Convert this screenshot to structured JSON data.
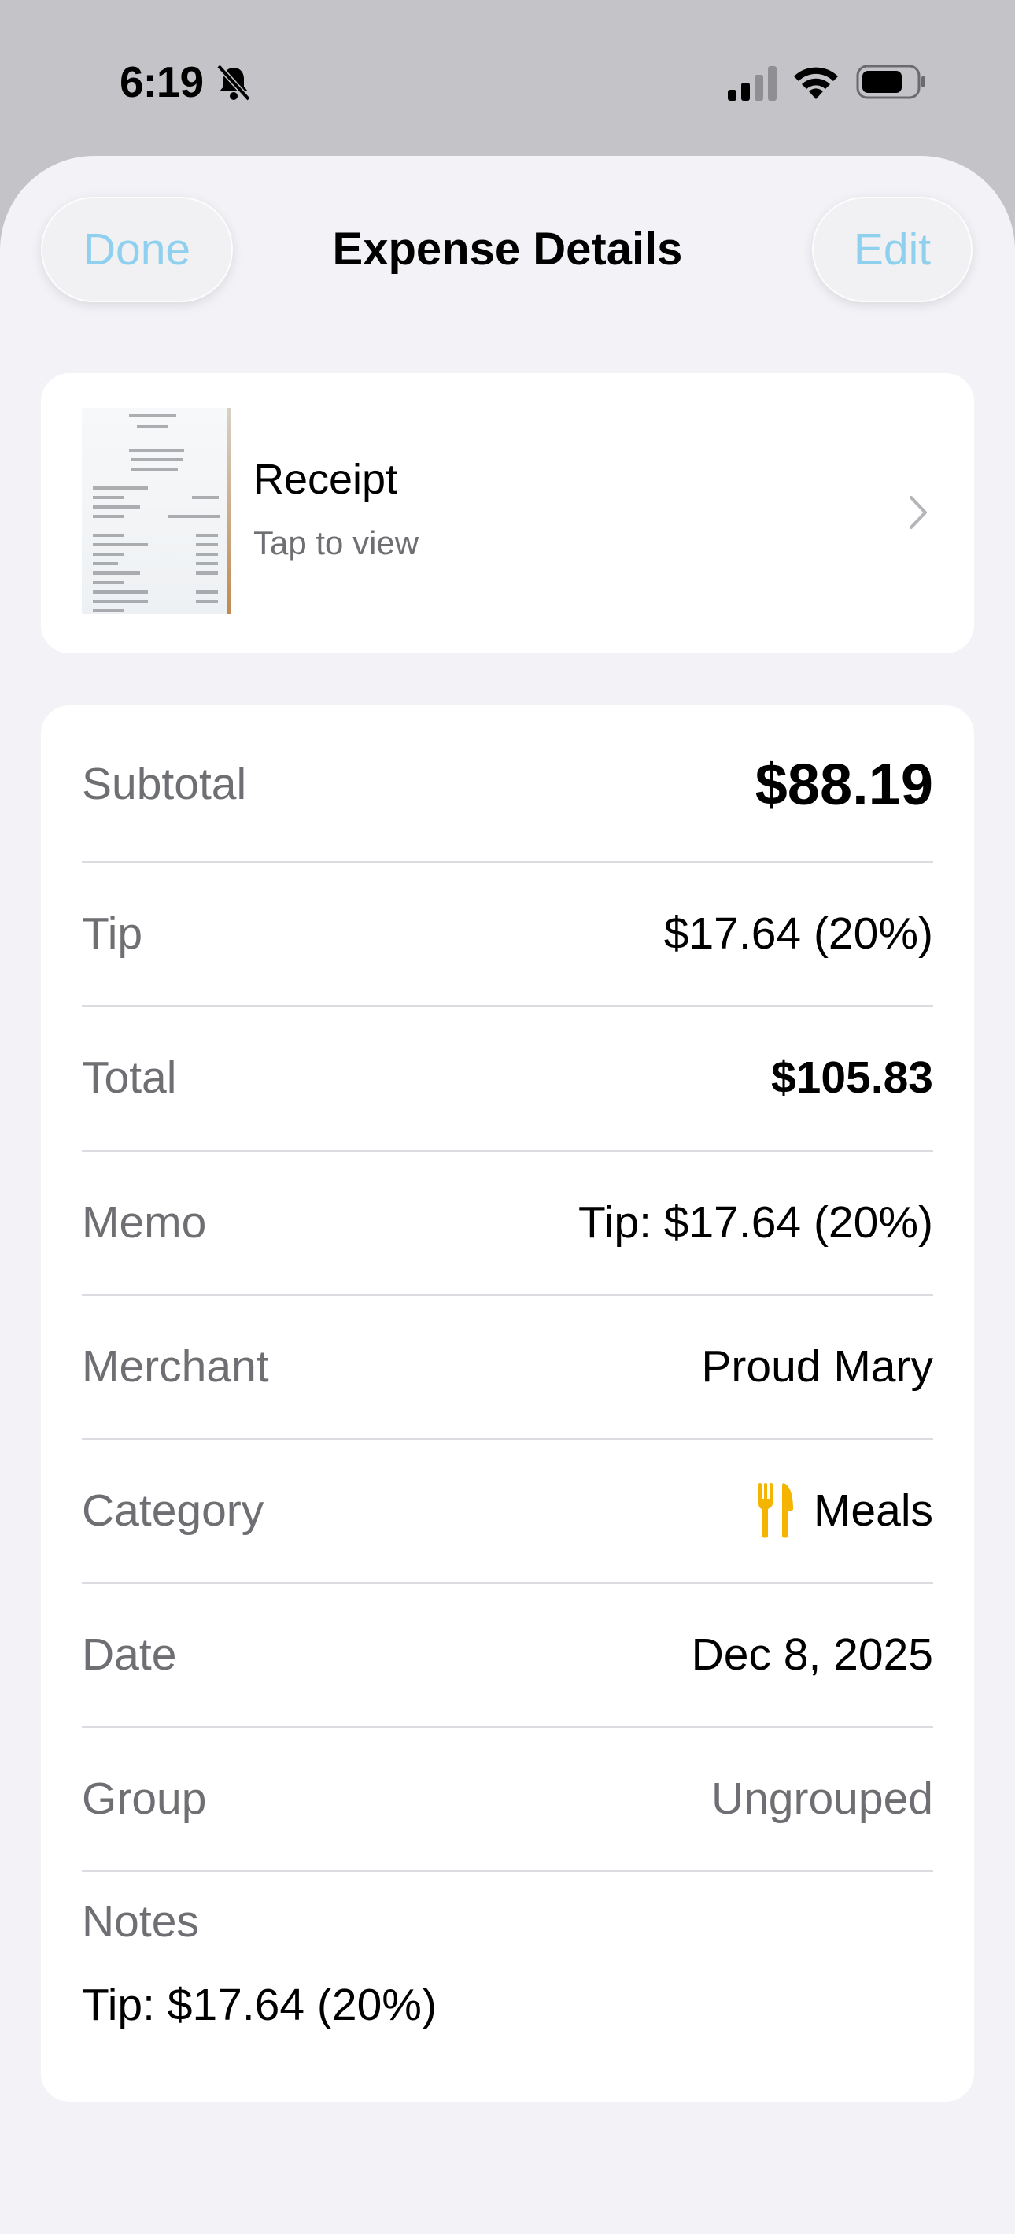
{
  "status_bar": {
    "time": "6:19"
  },
  "nav": {
    "done_label": "Done",
    "title": "Expense Details",
    "edit_label": "Edit",
    "accent_color": "#8fd0ee"
  },
  "receipt": {
    "title": "Receipt",
    "subtitle": "Tap to view"
  },
  "details": {
    "subtotal": {
      "label": "Subtotal",
      "value": "$88.19"
    },
    "tip": {
      "label": "Tip",
      "value": "$17.64 (20%)"
    },
    "total": {
      "label": "Total",
      "value": "$105.83"
    },
    "memo": {
      "label": "Memo",
      "value": "Tip: $17.64 (20%)"
    },
    "merchant": {
      "label": "Merchant",
      "value": "Proud Mary"
    },
    "category": {
      "label": "Category",
      "value": "Meals",
      "icon": "fork-knife-icon",
      "icon_color": "#f5b400"
    },
    "date": {
      "label": "Date",
      "value": "Dec 8, 2025"
    },
    "group": {
      "label": "Group",
      "value": "Ungrouped"
    },
    "notes": {
      "label": "Notes",
      "value": "Tip: $17.64 (20%)"
    }
  }
}
